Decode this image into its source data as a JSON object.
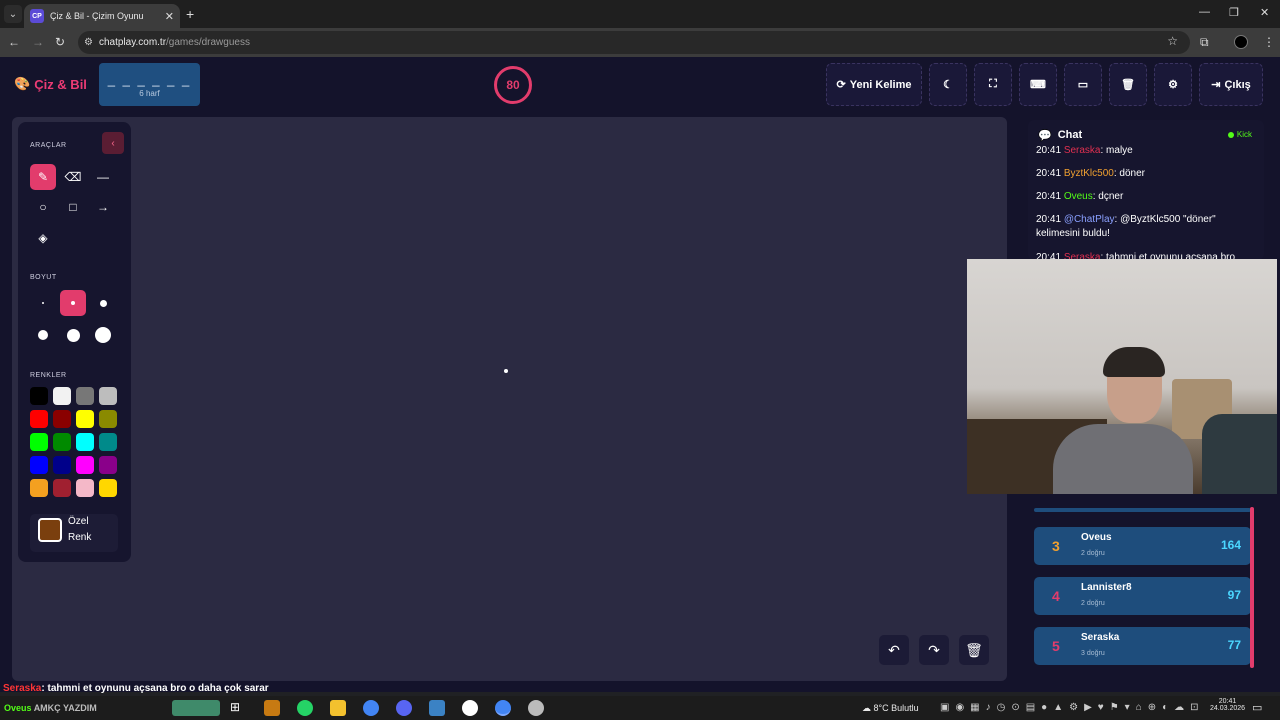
{
  "browser": {
    "tab_favicon": "CP",
    "tab_title": "Çiz & Bil - Çizim Oyunu",
    "url_host": "chatplay.com.tr",
    "url_path": "/games/drawguess"
  },
  "header": {
    "logo_text": "Çiz & Bil",
    "word_blanks": "_ _ _ _ _ _",
    "word_hint": "6 harf",
    "timer": "80",
    "new_word_label": "Yeni Kelime",
    "exit_label": "Çıkış"
  },
  "tools": {
    "tools_heading": "ARAÇLAR",
    "size_heading": "BOYUT",
    "colors_heading": "RENKLER",
    "custom_color_line1": "Özel",
    "custom_color_line2": "Renk",
    "palette": [
      "#000000",
      "#f2f2f2",
      "#777777",
      "#bdbdbd",
      "#ff0000",
      "#8a0000",
      "#ffff00",
      "#8a8a00",
      "#00ff00",
      "#008a00",
      "#00ffff",
      "#008a8a",
      "#0000ff",
      "#00008a",
      "#ff00ff",
      "#8a008a",
      "#f4a020",
      "#a02030",
      "#f4b8c8",
      "#ffd700"
    ],
    "custom_color": "#7a3f0e"
  },
  "chat": {
    "title": "Chat",
    "platform": "Kick",
    "messages": [
      {
        "time": "20:41",
        "user": "Seraska",
        "user_color": "#e03050",
        "text": "malye"
      },
      {
        "time": "20:41",
        "user": "ByztKlc500",
        "user_color": "#f0a030",
        "text": "döner"
      },
      {
        "time": "20:41",
        "user": "Oveus",
        "user_color": "#53fc18",
        "text": "dçner"
      },
      {
        "time": "20:41",
        "user": "@ChatPlay",
        "user_color": "#8aa0ff",
        "text": "@ByztKlc500 \"döner\" kelimesini buldu!"
      },
      {
        "time": "20:41",
        "user": "Seraska",
        "user_color": "#e03050",
        "text": "tahmni et oynunu açsana bro"
      }
    ]
  },
  "leaderboard": [
    {
      "rank": "3",
      "name": "Oveus",
      "sub": "2 doğru",
      "score": "164",
      "rank_color": "#f0a030"
    },
    {
      "rank": "4",
      "name": "Lannister8",
      "sub": "2 doğru",
      "score": "97",
      "rank_color": "#e23c6c"
    },
    {
      "rank": "5",
      "name": "Seraska",
      "sub": "3 doğru",
      "score": "77",
      "rank_color": "#e23c6c"
    }
  ],
  "overlay": {
    "user": "Seraska",
    "text": ": tahmni et oynunu açsana bro o daha çok sarar",
    "user2": "Oveus",
    "text2": "AMKÇ YAZDIM"
  },
  "taskbar": {
    "weather": "8°C  Bulutlu",
    "time": "20:41",
    "date": "24.03.2026"
  }
}
